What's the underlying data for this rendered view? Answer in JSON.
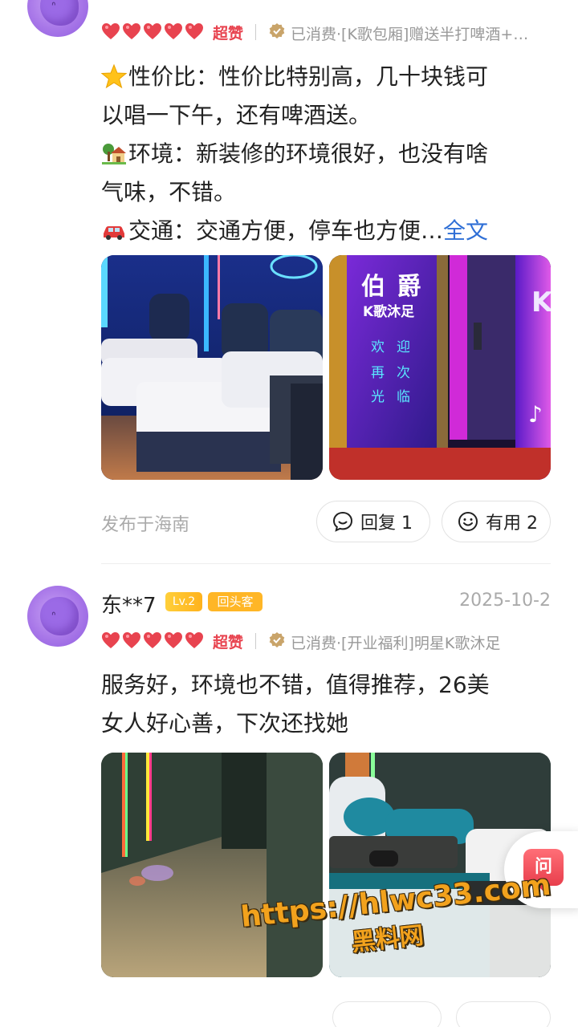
{
  "review1": {
    "rating_label": "超赞",
    "consume": "已消费·[K歌包厢]赠送半打啤酒+…",
    "lines": [
      "性价比：性价比特别高，几十块钱可",
      "以唱一下午，还有啤酒送。",
      "环境：新装修的环境很好，也没有啥",
      "气味，不错。",
      "交通：交通方便，停车也方便…"
    ],
    "full_link": "全文",
    "photo_right_text": {
      "sign_top": "伯 爵",
      "sign_sub": "K歌沐足",
      "welcome": [
        "欢",
        "迎",
        "再",
        "次",
        "光",
        "临"
      ]
    },
    "location": "发布于海南",
    "reply_label": "回复 1",
    "useful_label": "有用 2"
  },
  "review2": {
    "username": "东**7",
    "level": "Lv.2",
    "tag": "回头客",
    "date": "2025-10-2",
    "rating_label": "超赞",
    "consume": "已消费·[开业福利]明星K歌沐足",
    "lines": [
      "服务好，环境也不错，值得推荐，26美",
      "女人好心善，下次还找她"
    ]
  },
  "ask_button": "问",
  "watermark": {
    "url": "https://hlwc33.com",
    "name": "黑料网"
  },
  "colors": {
    "heart": "#e8434f",
    "link": "#2f6fd6",
    "badge_yellow": "#ffb626",
    "muted": "#aaaaaa"
  }
}
